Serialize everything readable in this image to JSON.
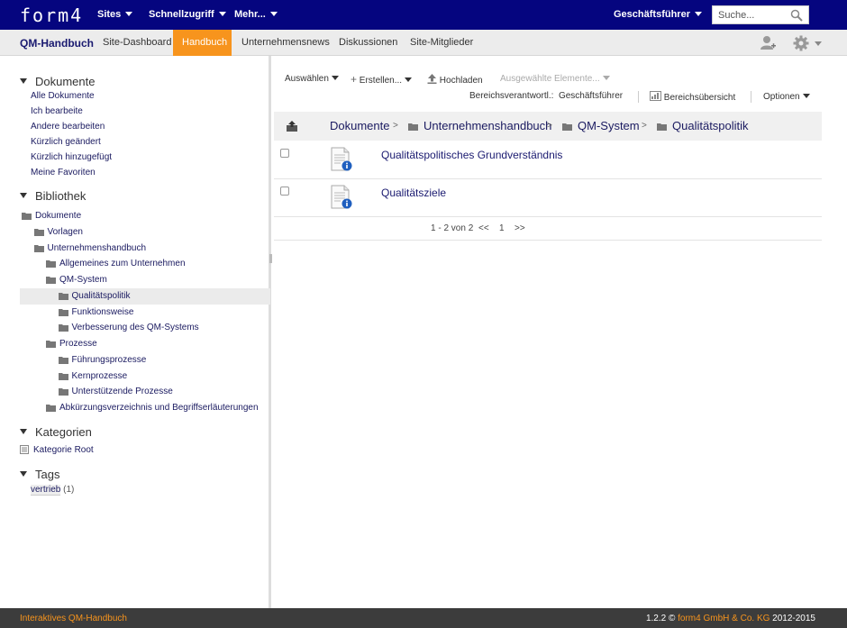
{
  "topbar": {
    "logo": "form4",
    "nav": [
      {
        "label": "Sites"
      },
      {
        "label": "Schnellzugriff"
      },
      {
        "label": "Mehr..."
      }
    ],
    "user_menu": "Geschäftsführer",
    "search_placeholder": "Suche..."
  },
  "sitebar": {
    "site_title": "QM-Handbuch",
    "tabs": [
      {
        "label": "Site-Dashboard"
      },
      {
        "label": "Handbuch"
      },
      {
        "label": "Unternehmensnews"
      },
      {
        "label": "Diskussionen"
      },
      {
        "label": "Site-Mitglieder"
      }
    ],
    "active_tab": "Handbuch"
  },
  "sidebar": {
    "documents_heading": "Dokumente",
    "document_links": [
      "Alle Dokumente",
      "Ich bearbeite",
      "Andere bearbeiten",
      "Kürzlich geändert",
      "Kürzlich hinzugefügt",
      "Meine Favoriten"
    ],
    "library_heading": "Bibliothek",
    "tree": [
      {
        "label": "Dokumente",
        "level": 0
      },
      {
        "label": "Vorlagen",
        "level": 1
      },
      {
        "label": "Unternehmenshandbuch",
        "level": 1
      },
      {
        "label": "Allgemeines zum Unternehmen",
        "level": 2
      },
      {
        "label": "QM-System",
        "level": 2
      },
      {
        "label": "Qualitätspolitik",
        "level": 3,
        "selected": true
      },
      {
        "label": "Funktionsweise",
        "level": 3
      },
      {
        "label": "Verbesserung des QM-Systems",
        "level": 3
      },
      {
        "label": "Prozesse",
        "level": 2
      },
      {
        "label": "Führungsprozesse",
        "level": 3
      },
      {
        "label": "Kernprozesse",
        "level": 3
      },
      {
        "label": "Unterstützende Prozesse",
        "level": 3
      },
      {
        "label": "Abkürzungsverzeichnis und Begriffserläuterungen",
        "level": 2
      }
    ],
    "categories_heading": "Kategorien",
    "category_root": "Kategorie Root",
    "tags_heading": "Tags",
    "tags": [
      {
        "label": "vertrieb",
        "count": "(1)"
      }
    ]
  },
  "toolbar": {
    "select": "Auswählen",
    "create": "Erstellen...",
    "upload": "Hochladen",
    "selected_items": "Ausgewählte Elemente...",
    "owner_label": "Bereichsverantwortl.:",
    "owner_value": "Geschäftsführer",
    "overview": "Bereichsübersicht",
    "options": "Optionen"
  },
  "breadcrumb": [
    "Dokumente",
    "Unternehmenshandbuch",
    "QM-System",
    "Qualitätspolitik"
  ],
  "breadcrumb_separator": ">",
  "documents": [
    {
      "title": "Qualitätspolitisches Grundverständnis"
    },
    {
      "title": "Qualitätsziele"
    }
  ],
  "pager": {
    "summary": "1 - 2 von 2",
    "prev": "<<",
    "page": "1",
    "next": ">>"
  },
  "footer": {
    "left": "Interaktives QM-Handbuch",
    "version": "1.2.2 ©",
    "brand": "form4 GmbH & Co. KG",
    "years": "2012-2015"
  },
  "colors": {
    "topbar": "#05057f",
    "accent": "#f7941d",
    "link": "#1a1a60",
    "footer": "#3c3c3c"
  }
}
